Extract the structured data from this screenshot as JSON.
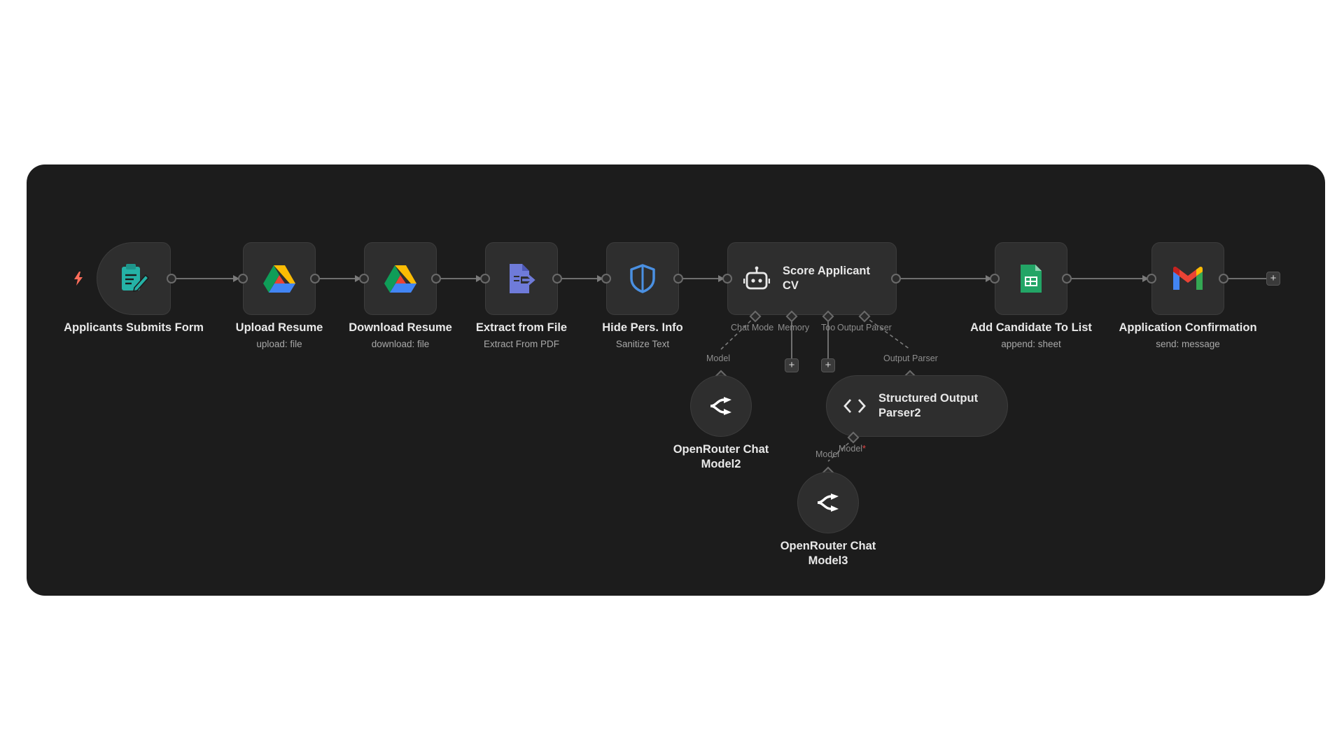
{
  "nodes": {
    "form": {
      "title": "Applicants Submits Form",
      "icon": "form-icon"
    },
    "upload": {
      "title": "Upload Resume",
      "subtitle": "upload: file",
      "icon": "google-drive-icon"
    },
    "download": {
      "title": "Download Resume",
      "subtitle": "download: file",
      "icon": "google-drive-icon"
    },
    "extract": {
      "title": "Extract from File",
      "subtitle": "Extract From PDF",
      "icon": "extract-file-icon"
    },
    "hide": {
      "title": "Hide Pers. Info",
      "subtitle": "Sanitize Text",
      "icon": "shield-icon"
    },
    "score": {
      "title_line1": "Score Applicant",
      "title_line2": "CV",
      "icon": "robot-icon"
    },
    "sheet": {
      "title": "Add Candidate To List",
      "subtitle": "append: sheet",
      "icon": "google-sheets-icon"
    },
    "gmail": {
      "title": "Application Confirmation",
      "subtitle": "send: message",
      "icon": "gmail-icon"
    },
    "model2": {
      "title_line1": "OpenRouter Chat",
      "title_line2": "Model2",
      "icon": "openrouter-icon"
    },
    "parser": {
      "title_line1": "Structured Output",
      "title_line2": "Parser2",
      "icon": "code-icon"
    },
    "model3": {
      "title_line1": "OpenRouter Chat",
      "title_line2": "Model3",
      "icon": "openrouter-icon"
    }
  },
  "ports": {
    "chat_model": "Chat Mode",
    "memory": "Memory",
    "tool": "Too",
    "output_parser": "Output Parser",
    "model": "Model",
    "output_parser_target": "Output Parser",
    "parser_model": "Model",
    "required_mark": "*",
    "model3_model": "Model"
  },
  "buttons": {
    "plus": "+"
  },
  "colors": {
    "canvas": "#1c1c1c",
    "node": "#2e2e2e",
    "trigger": "#ff6d5a",
    "form_teal": "#25b2a6",
    "extract_purple": "#6f7bd9",
    "shield_blue": "#4a90e2",
    "sheets_green": "#23a566"
  }
}
